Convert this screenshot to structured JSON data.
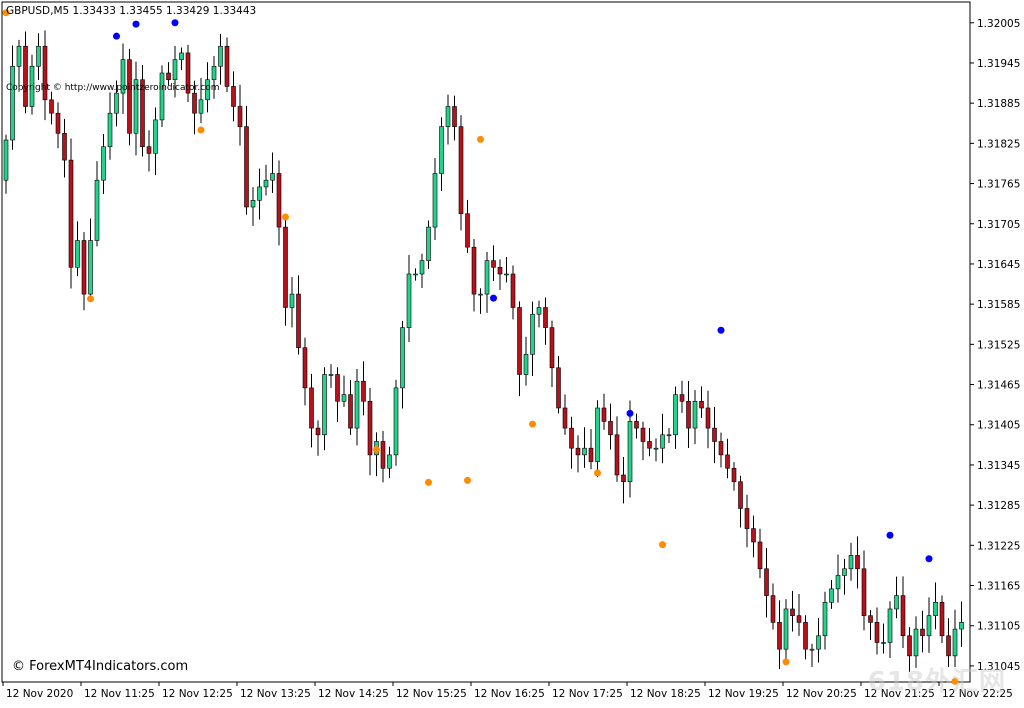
{
  "window": {
    "header": "GBPUSD,M5  1.33433 1.33455 1.33429 1.33443",
    "copyright_line": "Copyright © http://www.pointzeroindicator.com",
    "footer_brand": "© ForexMT4Indicators.com",
    "watermark": "618外汇网"
  },
  "colors": {
    "background": "#ffffff",
    "frame": "#000000",
    "bull": "#22d38a",
    "bear": "#b5121b",
    "wick": "#000000",
    "dot_high": "#0000ff",
    "dot_low": "#ff8c00",
    "text": "#000000"
  },
  "chart_data": {
    "type": "candlestick",
    "symbol": "GBPUSD",
    "timeframe": "M5",
    "ylim": [
      1.31021,
      1.32036
    ],
    "yticks": [
      "1.32005",
      "1.31945",
      "1.31885",
      "1.31825",
      "1.31765",
      "1.31705",
      "1.31645",
      "1.31585",
      "1.31525",
      "1.31465",
      "1.31405",
      "1.31345",
      "1.31285",
      "1.31225",
      "1.31165",
      "1.31105",
      "1.31045"
    ],
    "xticks": [
      "12 Nov 2020",
      "12 Nov 11:25",
      "12 Nov 12:25",
      "12 Nov 13:25",
      "12 Nov 14:25",
      "12 Nov 15:25",
      "12 Nov 16:25",
      "12 Nov 17:25",
      "12 Nov 18:25",
      "12 Nov 19:25",
      "12 Nov 20:25",
      "12 Nov 21:25",
      "12 Nov 22:25"
    ],
    "candles_per_tick": 12,
    "series": [
      {
        "name": "price",
        "mode": "walk",
        "start": 1.3177,
        "closes": [
          1.3183,
          1.3194,
          1.3197,
          1.3188,
          1.3194,
          1.3197,
          1.3189,
          1.3187,
          1.3184,
          1.318,
          1.3164,
          1.3168,
          1.316,
          1.3168,
          1.3177,
          1.3182,
          1.3187,
          1.319,
          1.3195,
          1.3184,
          1.3192,
          1.3182,
          1.3181,
          1.3186,
          1.3193,
          1.3192,
          1.3195,
          1.3196,
          1.319,
          1.3187,
          1.3189,
          1.3192,
          1.3194,
          1.3197,
          1.3191,
          1.3188,
          1.3185,
          1.3173,
          1.3174,
          1.3176,
          1.3177,
          1.3178,
          1.317,
          1.3158,
          1.316,
          1.3152,
          1.3146,
          1.314,
          1.3139,
          1.3148,
          1.3148,
          1.3144,
          1.3145,
          1.314,
          1.3147,
          1.3144,
          1.3136,
          1.3138,
          1.3134,
          1.3136,
          1.3146,
          1.3155,
          1.3163,
          1.3163,
          1.3165,
          1.317,
          1.3178,
          1.3185,
          1.3188,
          1.3185,
          1.3172,
          1.3167,
          1.316,
          1.316,
          1.3165,
          1.3164,
          1.3163,
          1.3163,
          1.3158,
          1.3148,
          1.3151,
          1.3157,
          1.3158,
          1.3155,
          1.3149,
          1.3143,
          1.314,
          1.3137,
          1.3136,
          1.3137,
          1.3135,
          1.3143,
          1.3141,
          1.3139,
          1.3133,
          1.3132,
          1.3141,
          1.314,
          1.3138,
          1.3137,
          1.3137,
          1.3139,
          1.3139,
          1.3145,
          1.3144,
          1.314,
          1.3144,
          1.3143,
          1.314,
          1.3138,
          1.3136,
          1.3134,
          1.3132,
          1.3128,
          1.3125,
          1.3123,
          1.3119,
          1.3115,
          1.3111,
          1.3107,
          1.3113,
          1.3112,
          1.3111,
          1.3107,
          1.3107,
          1.3109,
          1.3114,
          1.3116,
          1.3118,
          1.3119,
          1.3121,
          1.3119,
          1.3112,
          1.3111,
          1.3108,
          1.3108,
          1.3113,
          1.3115,
          1.3109,
          1.3106,
          1.311,
          1.3109,
          1.3112,
          1.3114,
          1.3109,
          1.3106,
          1.311,
          1.3111,
          1.3108,
          1.3103,
          1.3106
        ]
      },
      {
        "name": "highs-lows",
        "mode": "markers",
        "highs": [
          [
            17,
            1.31985
          ],
          [
            20,
            1.32003
          ],
          [
            26,
            1.32005
          ],
          [
            75,
            1.31594
          ],
          [
            96,
            1.31422
          ],
          [
            110,
            1.31546
          ],
          [
            136,
            1.3124
          ],
          [
            142,
            1.31205
          ]
        ],
        "lows": [
          [
            0,
            1.3202
          ],
          [
            13,
            1.31593
          ],
          [
            30,
            1.31845
          ],
          [
            43,
            1.31715
          ],
          [
            57,
            1.31368
          ],
          [
            65,
            1.31319
          ],
          [
            71,
            1.31322
          ],
          [
            73,
            1.31831
          ],
          [
            81,
            1.31406
          ],
          [
            91,
            1.31333
          ],
          [
            101,
            1.31226
          ],
          [
            120,
            1.31051
          ],
          [
            146,
            1.31022
          ]
        ]
      }
    ]
  }
}
